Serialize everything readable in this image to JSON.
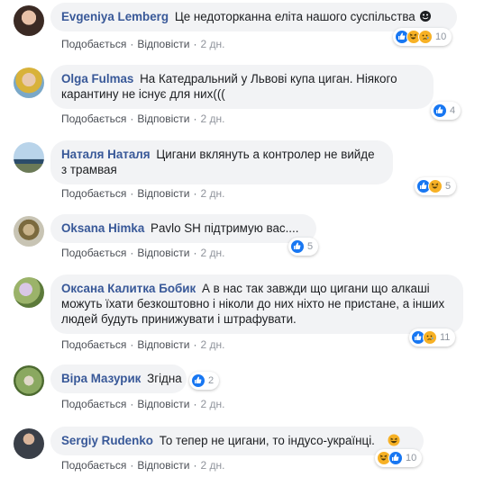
{
  "colors": {
    "author": "#385898",
    "bubble": "#f2f3f5",
    "like": "#1877f2",
    "haha": "#f7b125"
  },
  "actions": {
    "like": "Подобається",
    "reply": "Відповісти"
  },
  "comments": [
    {
      "author": "Evgeniya Lemberg",
      "text": "Це недоторканна еліта нашого суспільства",
      "time": "2 дн.",
      "reactions": [
        "like",
        "haha",
        "sad"
      ],
      "count": "10",
      "avatar": "woman-dark-hair"
    },
    {
      "author": "Olga Fulmas",
      "text": "На Катедральний у Львові купа циган. Ніякого карантину не існує для них(((",
      "time": "2 дн.",
      "reactions": [
        "like"
      ],
      "count": "4",
      "avatar": "woman-blonde"
    },
    {
      "author": "Наталя Наталя",
      "text": "Цигани вклянуть а контролер не вийде з трамвая",
      "time": "2 дн.",
      "reactions": [
        "like",
        "haha"
      ],
      "count": "5",
      "avatar": "seascape"
    },
    {
      "author": "Oksana Himka",
      "text": "Pavlo SH підтримую вас....",
      "time": "2 дн.",
      "reactions": [
        "like"
      ],
      "count": "5",
      "avatar": "icon-painting"
    },
    {
      "author": "Оксана Калитка Бобик",
      "text": "А в нас так завжди що цигани що алкаші можуть їхати безкоштовно і ніколи до них ніхто не пристане, а інших людей будуть принижувати і штрафувати.",
      "time": "2 дн.",
      "reactions": [
        "like",
        "sad"
      ],
      "count": "11",
      "avatar": "flowers"
    },
    {
      "author": "Віра Мазурик",
      "text": "Згідна",
      "time": "2 дн.",
      "reactions": [
        "like"
      ],
      "count": "2",
      "avatar": "garden"
    },
    {
      "author": "Sergiy Rudenko",
      "text": "То тепер не цигани, то індусо-українці.",
      "time": "2 дн.",
      "reactions": [
        "haha",
        "like"
      ],
      "count": "10",
      "avatar": "man-portrait"
    }
  ]
}
